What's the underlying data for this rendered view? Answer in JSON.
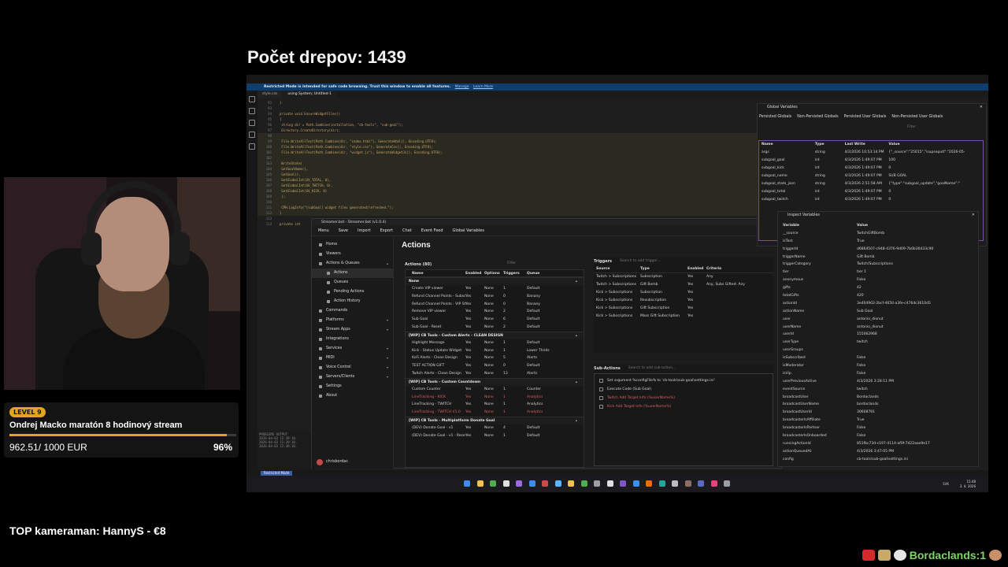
{
  "stream": {
    "title": "Počet drepov: 1439",
    "top_cameraman": "TOP kameraman: HannyS - €8",
    "counter_label": "Bordaclands:1"
  },
  "goal": {
    "level": "LEVEL 9",
    "title": "Ondrej Macko maratón 8 hodinový stream",
    "amount": "962.51/ 1000 EUR",
    "percent_label": "96%",
    "progress": 0.96,
    "accent": "#e5a41f"
  },
  "vscode": {
    "banner_text": "Restricted Mode is intended for safe code browsing. Trust this window to enable all features.",
    "banner_manage": "Manage",
    "banner_learn": "Learn More",
    "tabs": [
      "style.css",
      "using System; Untitled-1"
    ],
    "status_badge": "Restricted Mode",
    "panel_tabs": "PROBLEMS   OUTPUT",
    "panel_lines": [
      "2026-04-03 15:39:10.",
      "2026-04-03 15:39:10.",
      "2026-04-03 15:39:10."
    ],
    "code": [
      {
        "n": "92",
        "t": "}"
      },
      {
        "n": "93",
        "t": ""
      },
      {
        "n": "94",
        "t": "private void EnsureWidgetFiles()"
      },
      {
        "n": "95",
        "t": "{"
      },
      {
        "n": "96",
        "t": "    string dir = Path.Combine(installation, \"cb-tools\", \"sub-goal\");"
      },
      {
        "n": "97",
        "t": "    Directory.CreateDirectory(dir);"
      },
      {
        "n": "98",
        "t": ""
      },
      {
        "n": "99",
        "t": "    File.WriteAllText(Path.Combine(dir, \"index.html\"), GenerateHtml(), Encoding.UTF8);"
      },
      {
        "n": "100",
        "t": "    File.WriteAllText(Path.Combine(dir, \"style.css\"), GenerateCss(), Encoding.UTF8);"
      },
      {
        "n": "101",
        "t": "    File.WriteAllText(Path.Combine(dir, \"widget.js\"), GenerateWidgetJs(), Encoding.UTF8);"
      },
      {
        "n": "102",
        "t": ""
      },
      {
        "n": "103",
        "t": "    WriteState("
      },
      {
        "n": "104",
        "t": "        GetGoalName(),"
      },
      {
        "n": "105",
        "t": "        GetGoal(),"
      },
      {
        "n": "106",
        "t": "        GetGlobalInt(GV_TOTAL, 0),"
      },
      {
        "n": "107",
        "t": "        GetGlobalInt(GV_TWITCH, 0),"
      },
      {
        "n": "108",
        "t": "        GetGlobalInt(GV_KICK, 0)"
      },
      {
        "n": "109",
        "t": "    );"
      },
      {
        "n": "110",
        "t": ""
      },
      {
        "n": "111",
        "t": "    CPH.LogInfo(\"[subGoal] widget files generated/refreshed.\");"
      },
      {
        "n": "112",
        "t": "}"
      },
      {
        "n": "113",
        "t": ""
      },
      {
        "n": "114",
        "t": "private int"
      }
    ]
  },
  "streamerbot": {
    "window_title": "Streamer.bot - Streamer.bot (v1.0.4)",
    "menu": [
      "Menu",
      "Save",
      "Import",
      "Export",
      "Chat",
      "Event Feed",
      "Global Variables"
    ],
    "page_title": "Actions",
    "nav": [
      {
        "label": "Home",
        "sub": false,
        "chev": ""
      },
      {
        "label": "Viewers",
        "sub": false,
        "chev": ""
      },
      {
        "label": "Actions & Queues",
        "sub": false,
        "chev": "▴"
      },
      {
        "label": "Actions",
        "sub": true,
        "chev": "",
        "active": true
      },
      {
        "label": "Queues",
        "sub": true,
        "chev": ""
      },
      {
        "label": "Pending Actions",
        "sub": true,
        "chev": ""
      },
      {
        "label": "Action History",
        "sub": true,
        "chev": ""
      },
      {
        "label": "Commands",
        "sub": false,
        "chev": ""
      },
      {
        "label": "Platforms",
        "sub": false,
        "chev": "▾"
      },
      {
        "label": "Stream Apps",
        "sub": false,
        "chev": "▾"
      },
      {
        "label": "Integrations",
        "sub": false,
        "chev": ""
      },
      {
        "label": "Services",
        "sub": false,
        "chev": "▾"
      },
      {
        "label": "MIDI",
        "sub": false,
        "chev": "▾"
      },
      {
        "label": "Voice Control",
        "sub": false,
        "chev": "▾"
      },
      {
        "label": "Servers/Clients",
        "sub": false,
        "chev": "▾"
      },
      {
        "label": "Settings",
        "sub": false,
        "chev": ""
      },
      {
        "label": "About",
        "sub": false,
        "chev": ""
      }
    ],
    "user": "chrisbordac",
    "actions_title": "Actions (80)",
    "actions_filter": "Filter",
    "actions_columns": [
      "Name",
      "Enabled",
      "Options",
      "Triggers",
      "Queue"
    ],
    "action_groups": [
      {
        "name": "None",
        "rows": [
          {
            "name": "Create VIP viewer",
            "en": "Yes",
            "op": "None",
            "tr": "1",
            "q": "Default"
          },
          {
            "name": "Refund Channel Points - Subsc",
            "en": "Yes",
            "op": "None",
            "tr": "0",
            "q": "Banany"
          },
          {
            "name": "Refund Channel Points - VIP St",
            "en": "Yes",
            "op": "None",
            "tr": "0",
            "q": "Banany"
          },
          {
            "name": "Remove VIP viewer",
            "en": "Yes",
            "op": "None",
            "tr": "2",
            "q": "Default"
          },
          {
            "name": "Sub Goal",
            "en": "Yes",
            "op": "None",
            "tr": "6",
            "q": "Default"
          },
          {
            "name": "Sub Goal - Reset",
            "en": "Yes",
            "op": "None",
            "tr": "2",
            "q": "Default"
          }
        ]
      },
      {
        "name": "[WIP] CB Tools - Custom Alerts - CLEAN DESIGN",
        "rows": [
          {
            "name": "Highlight Message",
            "en": "Yes",
            "op": "None",
            "tr": "1",
            "q": "Default"
          },
          {
            "name": "Kick - Status Update Widget",
            "en": "Yes",
            "op": "None",
            "tr": "1",
            "q": "Lower Thirds"
          },
          {
            "name": "KoFi Alerts - Clean Design",
            "en": "Yes",
            "op": "None",
            "tr": "5",
            "q": "Alerts"
          },
          {
            "name": "TEST ACTION GIFT",
            "en": "Yes",
            "op": "None",
            "tr": "0",
            "q": "Default"
          },
          {
            "name": "Twitch Alerts - Clean Design",
            "en": "Yes",
            "op": "None",
            "tr": "13",
            "q": "Alerts"
          }
        ]
      },
      {
        "name": "[WIP] CB Tools - Custom Countdown",
        "rows": [
          {
            "name": "Custom Counter",
            "en": "Yes",
            "op": "None",
            "tr": "1",
            "q": "Counter"
          },
          {
            "name": "LineTracking - KICK",
            "en": "Yes",
            "op": "None",
            "tr": "1",
            "q": "Analytics",
            "red": true
          },
          {
            "name": "LineTracking - TWITCH",
            "en": "Yes",
            "op": "None",
            "tr": "1",
            "q": "Analytics"
          },
          {
            "name": "LineTracking - TWITCH V1.0",
            "en": "Yes",
            "op": "None",
            "tr": "1",
            "q": "Analytics",
            "red": true
          }
        ]
      },
      {
        "name": "[WIP] CB Tools - Multiplatform Donate Goal",
        "rows": [
          {
            "name": "(DEV) Donate Goal - v1",
            "en": "Yes",
            "op": "None",
            "tr": "4",
            "q": "Default"
          },
          {
            "name": "(DEV) Donate Goal - v1 - Reset",
            "en": "Yes",
            "op": "None",
            "tr": "1",
            "q": "Default"
          }
        ]
      }
    ],
    "triggers_title": "Triggers",
    "triggers_search": "Search to add trigger...",
    "triggers_columns": [
      "Source",
      "Type",
      "Enabled",
      "Criteria"
    ],
    "triggers": [
      {
        "src": "Twitch > Subscriptions",
        "type": "Subscription",
        "en": "Yes",
        "cr": "Any"
      },
      {
        "src": "Twitch > Subscriptions",
        "type": "Gift Bomb",
        "en": "Yes",
        "cr": "Any, Subs Gifted: Any"
      },
      {
        "src": "Kick > Subscriptions",
        "type": "Subscription",
        "en": "Yes",
        "cr": ""
      },
      {
        "src": "Kick > Subscriptions",
        "type": "Resubscription",
        "en": "Yes",
        "cr": ""
      },
      {
        "src": "Kick > Subscriptions",
        "type": "Gift Subscription",
        "en": "Yes",
        "cr": ""
      },
      {
        "src": "Kick > Subscriptions",
        "type": "Mass Gift Subscription",
        "en": "Yes",
        "cr": ""
      }
    ],
    "subactions_title": "Sub-Actions",
    "subactions_search": "Search to add sub-action...",
    "subactions": [
      {
        "label": "Set argument %configFile% to 'cb-tools\\sub-goal\\settings.ini'",
        "red": false
      },
      {
        "label": "Execute Code (Sub Goal)",
        "red": false
      },
      {
        "label": "Twitch Add Target Info (%userName%)",
        "red": true
      },
      {
        "label": "Kick Add Target Info (%userName%)",
        "red": true
      }
    ]
  },
  "global_variables": {
    "title": "Global Variables",
    "tabs": [
      "Persisted Globals",
      "Non-Persisted Globals",
      "Persisted User Globals",
      "Non-Persisted User Globals"
    ],
    "filter": "Filter",
    "columns": [
      "Name",
      "Type",
      "Last Write",
      "Value"
    ],
    "rows": [
      {
        "name": "args",
        "type": "string",
        "lw": "4/2/2026 10:53:14 PM",
        "val": "{\"_source\":\"25015\",\"isupsepult\":\"2026-05-"
      },
      {
        "name": "subgoal_goal",
        "type": "int",
        "lw": "4/3/2026 1:49:07 PM",
        "val": "100"
      },
      {
        "name": "subgoal_kick",
        "type": "int",
        "lw": "4/3/2026 1:49:07 PM",
        "val": "0"
      },
      {
        "name": "subgoal_name",
        "type": "string",
        "lw": "4/3/2026 1:49:07 PM",
        "val": "SUB GOAL"
      },
      {
        "name": "subgoal_state_json",
        "type": "string",
        "lw": "4/3/2026 2:51:58 AM",
        "val": "{\"type\":\"subgoal_update\",\"goalName\":\""
      },
      {
        "name": "subgoal_total",
        "type": "int",
        "lw": "4/3/2026 1:49:07 PM",
        "val": "0"
      },
      {
        "name": "subgoal_twitch",
        "type": "int",
        "lw": "4/3/2026 1:49:07 PM",
        "val": "0"
      }
    ]
  },
  "inspect_variables": {
    "title": "Inspect Variables",
    "columns": [
      "Variable",
      "Value"
    ],
    "rows": [
      {
        "k": "__source",
        "v": "TwitchGiftBomb"
      },
      {
        "k": "isTest",
        "v": "True"
      },
      {
        "k": "triggerId",
        "v": "d6864507-c948-4376-9d09-7b0b36433c90"
      },
      {
        "k": "triggerName",
        "v": "Gift Bomb"
      },
      {
        "k": "triggerCategory",
        "v": "Twitch/Subscriptions"
      },
      {
        "k": "tier",
        "v": "tier 1"
      },
      {
        "k": "anonymous",
        "v": "False"
      },
      {
        "k": "gifts",
        "v": "42"
      },
      {
        "k": "totalGifts",
        "v": "420"
      },
      {
        "k": "actionId",
        "v": "3e404902-2bcf-4650-a3fe-c476dc3610d5"
      },
      {
        "k": "actionName",
        "v": "Sub Goal"
      },
      {
        "k": "user",
        "v": "antonio_dionut"
      },
      {
        "k": "userName",
        "v": "antonio_dionut"
      },
      {
        "k": "userId",
        "v": "155062968"
      },
      {
        "k": "userType",
        "v": "twitch"
      },
      {
        "k": "userGroups",
        "v": ""
      },
      {
        "k": "isSubscribed",
        "v": "False"
      },
      {
        "k": "isModerator",
        "v": "False"
      },
      {
        "k": "isVip",
        "v": "False"
      },
      {
        "k": "userPreviousActive",
        "v": "4/3/2026 3:28:11 PM"
      },
      {
        "k": "eventSource",
        "v": "twitch"
      },
      {
        "k": "broadcastUser",
        "v": "Bordaclands"
      },
      {
        "k": "broadcastUserName",
        "v": "bordaclands"
      },
      {
        "k": "broadcastUserId",
        "v": "30608791"
      },
      {
        "k": "broadcasterIsAffiliate",
        "v": "True"
      },
      {
        "k": "broadcasterIsPartner",
        "v": "False"
      },
      {
        "k": "broadcasterIsOnboarded",
        "v": "False"
      },
      {
        "k": "runningActionId",
        "v": "851fbc73d-c197-4114-af0f-7422aae9e17"
      },
      {
        "k": "actionQueuedAt",
        "v": "4/3/2026 3:47:05 PM"
      },
      {
        "k": "config",
        "v": "cb-tools\\sub-goal\\settings.ini"
      }
    ]
  },
  "taskbar": {
    "clock_time": "15:48",
    "clock_date": "3. 4. 2026",
    "lang": "SVK"
  }
}
